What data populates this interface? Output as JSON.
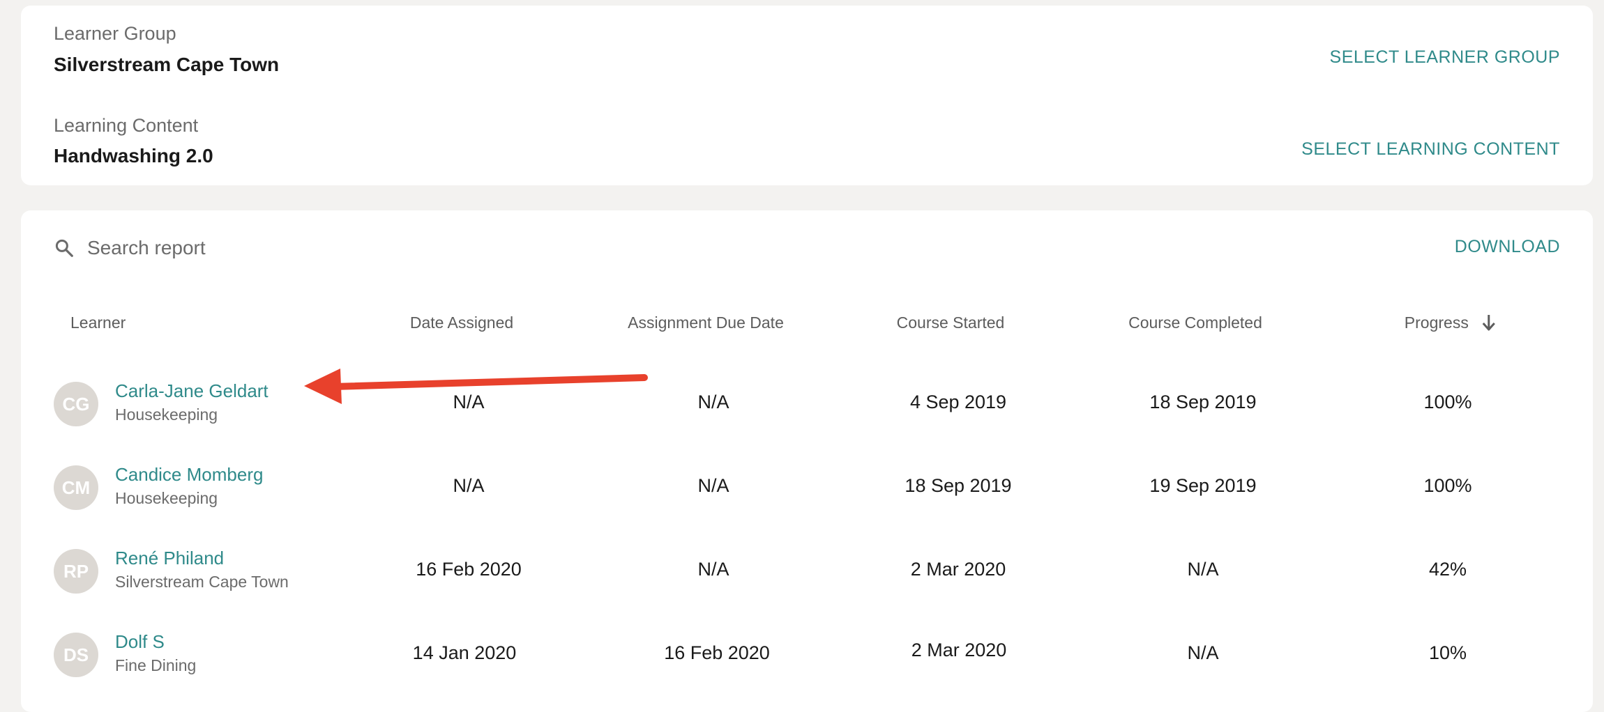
{
  "filters": {
    "learner_group": {
      "label": "Learner Group",
      "value": "Silverstream Cape Town",
      "action": "SELECT LEARNER GROUP"
    },
    "learning_content": {
      "label": "Learning Content",
      "value": "Handwashing 2.0",
      "action": "SELECT LEARNING CONTENT"
    }
  },
  "report": {
    "search": {
      "placeholder": "Search report",
      "value": ""
    },
    "download_label": "DOWNLOAD",
    "columns": [
      "Learner",
      "Date Assigned",
      "Assignment Due Date",
      "Course Started",
      "Course Completed",
      "Progress"
    ],
    "sort": {
      "column": "Progress",
      "direction": "descending",
      "icon": "arrow-down-icon"
    },
    "rows": [
      {
        "initials": "CG",
        "name": "Carla-Jane Geldart",
        "group": "Housekeeping",
        "date_assigned": "N/A",
        "due_date": "N/A",
        "started": "4 Sep 2019",
        "completed": "18 Sep 2019",
        "progress": "100%"
      },
      {
        "initials": "CM",
        "name": "Candice Momberg",
        "group": "Housekeeping",
        "date_assigned": "N/A",
        "due_date": "N/A",
        "started": "18 Sep 2019",
        "completed": "19 Sep 2019",
        "progress": "100%"
      },
      {
        "initials": "RP",
        "name": "René Philand",
        "group": "Silverstream Cape Town",
        "date_assigned": "16 Feb 2020",
        "due_date": "N/A",
        "started": "2 Mar 2020",
        "completed": "N/A",
        "progress": "42%"
      },
      {
        "initials": "DS",
        "name": "Dolf S",
        "group": "Fine Dining",
        "date_assigned": "14 Jan 2020",
        "due_date": "16 Feb 2020",
        "started": "2 Mar 2020",
        "completed": "N/A",
        "progress": "10%"
      }
    ]
  },
  "colors": {
    "accent": "#2f8a8a",
    "annotation_arrow": "#e8412c",
    "avatar_bg": "#dcd8d3",
    "page_bg": "#f3f2f0"
  }
}
